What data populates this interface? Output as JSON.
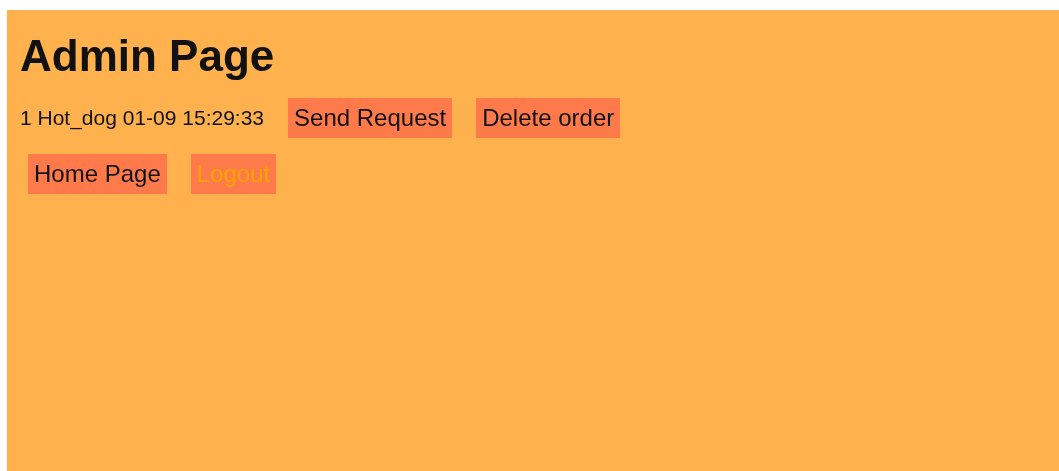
{
  "title": "Admin Page",
  "orders": [
    {
      "text": "1 Hot_dog 01-09 15:29:33",
      "actions": [
        "Send Request",
        "Delete order"
      ]
    }
  ],
  "nav_links": [
    {
      "label": "Home Page",
      "active": false
    },
    {
      "label": "Logout",
      "active": true
    }
  ]
}
